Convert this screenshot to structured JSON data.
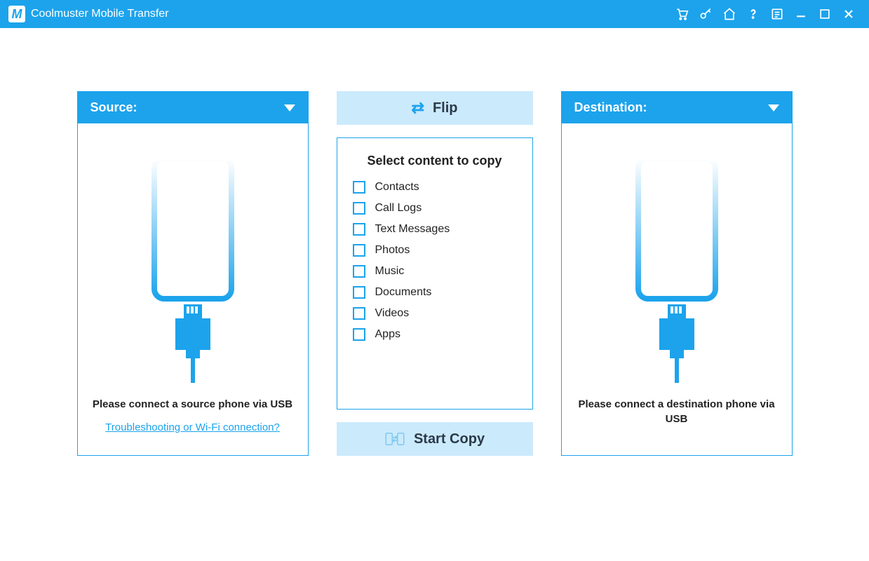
{
  "app": {
    "title": "Coolmuster Mobile Transfer"
  },
  "titlebar_icons": [
    "cart-icon",
    "key-icon",
    "home-icon",
    "help-icon",
    "feedback-icon",
    "minimize-icon",
    "maximize-icon",
    "close-icon"
  ],
  "source": {
    "header": "Source:",
    "message": "Please connect a source phone via USB",
    "link": "Troubleshooting or Wi-Fi connection?"
  },
  "destination": {
    "header": "Destination:",
    "message": "Please connect a destination phone via USB"
  },
  "center": {
    "flip_label": "Flip",
    "select_title": "Select content to copy",
    "options": [
      "Contacts",
      "Call Logs",
      "Text Messages",
      "Photos",
      "Music",
      "Documents",
      "Videos",
      "Apps"
    ],
    "start_label": "Start Copy"
  },
  "colors": {
    "primary": "#1ca3ec",
    "soft": "#cbeafc"
  }
}
